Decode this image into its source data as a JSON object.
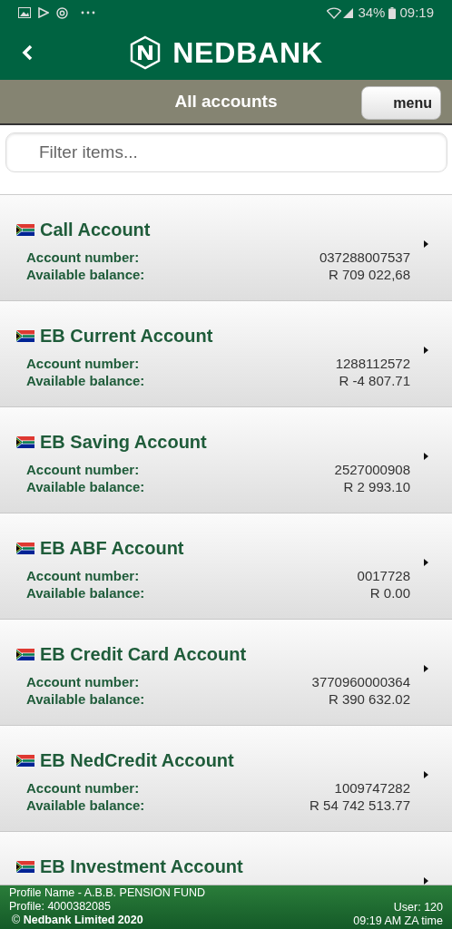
{
  "status_bar": {
    "battery": "34%",
    "time": "09:19"
  },
  "header": {
    "brand": "NEDBANK"
  },
  "title_bar": {
    "title": "All accounts",
    "menu_button": "menu"
  },
  "filter": {
    "placeholder": "Filter items..."
  },
  "accounts": [
    {
      "name": "Call Account",
      "number_label": "Account number:",
      "number": "037288007537",
      "balance_label": "Available balance:",
      "balance": "R 709 022,68"
    },
    {
      "name": "EB Current Account",
      "number_label": "Account number:",
      "number": "1288112572",
      "balance_label": "Available balance:",
      "balance": "R -4 807.71"
    },
    {
      "name": "EB Saving Account",
      "number_label": "Account number:",
      "number": "2527000908",
      "balance_label": "Available balance:",
      "balance": "R 2 993.10"
    },
    {
      "name": "EB ABF Account",
      "number_label": "Account number:",
      "number": "0017728",
      "balance_label": "Available balance:",
      "balance": "R 0.00"
    },
    {
      "name": "EB Credit Card Account",
      "number_label": "Account number:",
      "number": "3770960000364",
      "balance_label": "Available balance:",
      "balance": "R 390 632.02"
    },
    {
      "name": "EB NedCredit Account",
      "number_label": "Account number:",
      "number": "1009747282",
      "balance_label": "Available balance:",
      "balance": "R 54 742 513.77"
    },
    {
      "name": "EB Investment Account"
    }
  ],
  "footer": {
    "profile_name": "Profile Name - A.B.B. PENSION FUND",
    "profile": "Profile: 4000382085",
    "copyright": "© **Nedbank Limited 2020**",
    "user": "User: 120",
    "time": "09:19 AM ZA time"
  }
}
